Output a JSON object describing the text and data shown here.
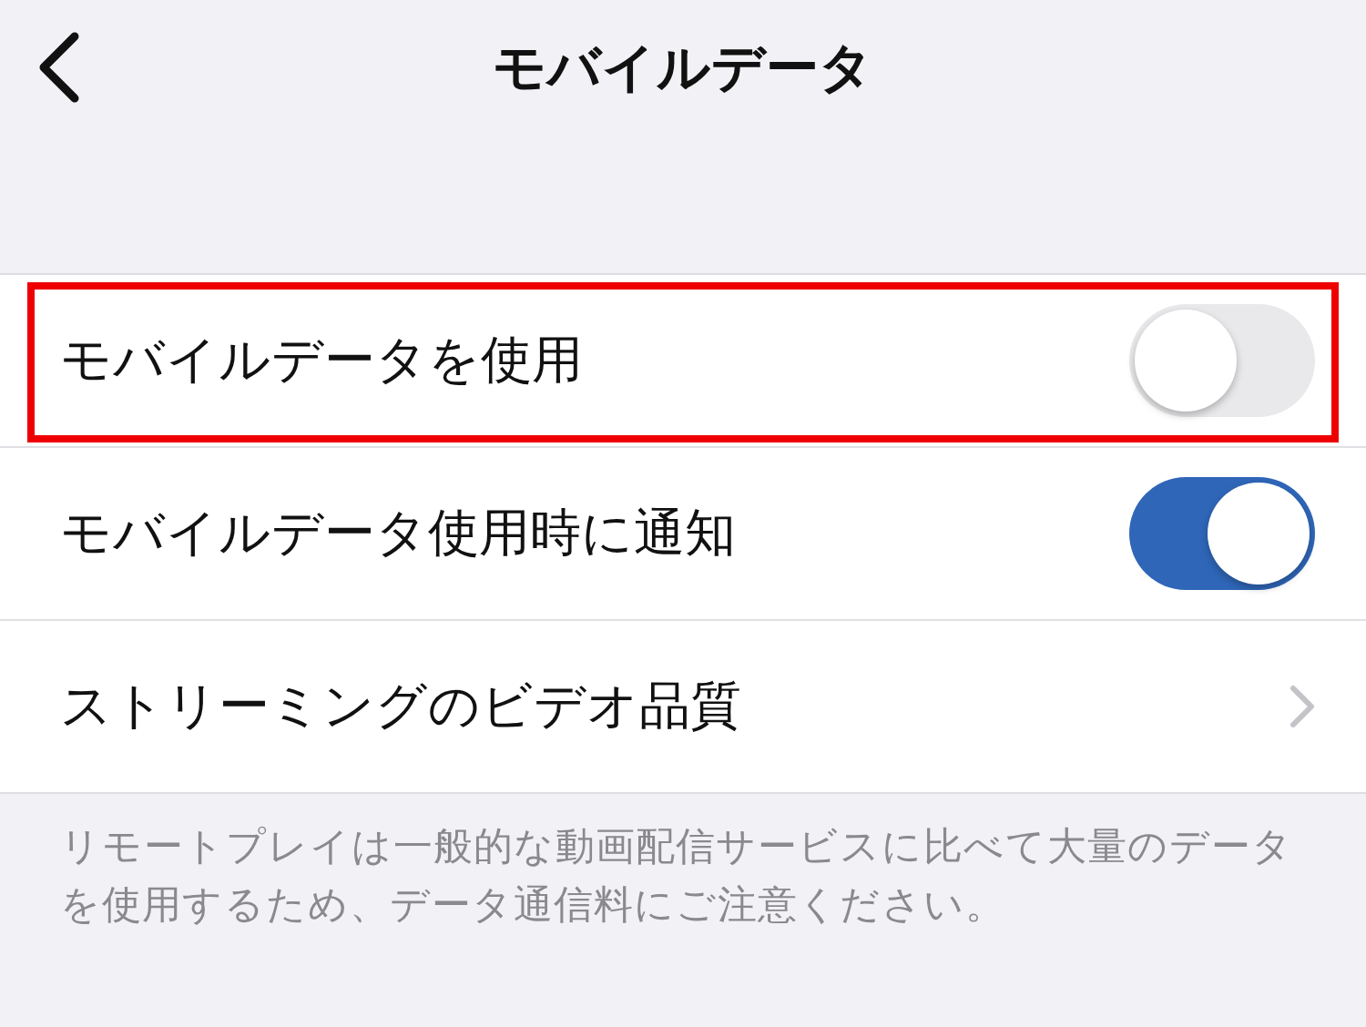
{
  "header": {
    "title": "モバイルデータ"
  },
  "rows": [
    {
      "kind": "toggle",
      "label": "モバイルデータを使用",
      "on": false,
      "highlighted": true
    },
    {
      "kind": "toggle",
      "label": "モバイルデータ使用時に通知",
      "on": true,
      "highlighted": false
    },
    {
      "kind": "link",
      "label": "ストリーミングのビデオ品質",
      "highlighted": false
    }
  ],
  "footer": "リモートプレイは一般的な動画配信サービスに比べて大量のデータを使用するため、データ通信料にご注意ください。"
}
